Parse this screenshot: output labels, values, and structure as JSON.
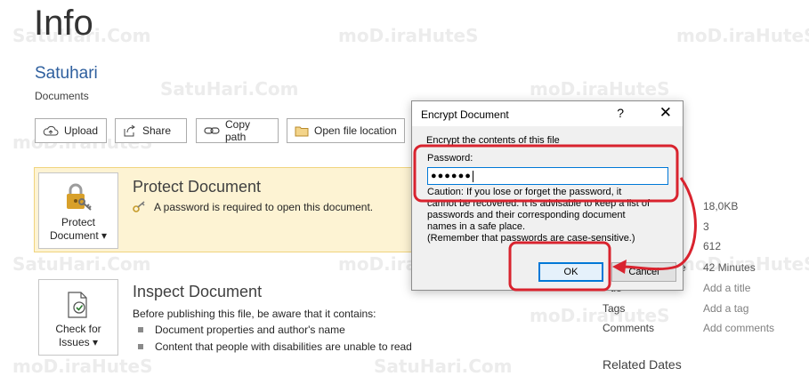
{
  "backstage": {
    "page_title": "Info",
    "file_name": "Satuhari",
    "location": "Documents",
    "toolbar": {
      "upload": "Upload",
      "share": "Share",
      "copy_path": "Copy path",
      "open_location": "Open file location"
    }
  },
  "protect": {
    "button_line1": "Protect",
    "button_line2": "Document ▾",
    "title": "Protect Document",
    "status": "A password is required to open this document."
  },
  "inspect": {
    "button_line1": "Check for",
    "button_line2": "Issues ▾",
    "title": "Inspect Document",
    "intro": "Before publishing this file, be aware that it contains:",
    "bullets": [
      "Document properties and author's name",
      "Content that people with disabilities are unable to read"
    ]
  },
  "properties": {
    "size_value": "18,0KB",
    "pages_value": "3",
    "words_value": "612",
    "edit_time_partial": "e",
    "edit_time_value": "42 Minutes",
    "title_partial": "tle",
    "title_value": "Add a title",
    "tags_label": "Tags",
    "tags_value": "Add a tag",
    "comments_label": "Comments",
    "comments_value": "Add comments",
    "related_dates": "Related Dates"
  },
  "dialog": {
    "title": "Encrypt Document",
    "help": "?",
    "close": "✕",
    "heading": "Encrypt the contents of this file",
    "password_label": "Password:",
    "password_value": "●●●●●●",
    "caution_line1": "Caution: If you lose or forget the password, it",
    "caution_line2": "cannot be recovered. It is advisable to keep a list of",
    "caution_line3": "passwords and their corresponding document",
    "caution_line4": "names in a safe place.",
    "caution_line5": "(Remember that passwords are case-sensitive.)",
    "ok": "OK",
    "cancel": "Cancel"
  },
  "watermarks": {
    "text": "SatuHari.Com",
    "mirrored": "moD.iraHuteS"
  },
  "colors": {
    "accent_blue": "#2e5f9e",
    "protect_bg": "#fdf3d3",
    "annotation_red": "#d9232e",
    "focus_blue": "#0078d7"
  }
}
